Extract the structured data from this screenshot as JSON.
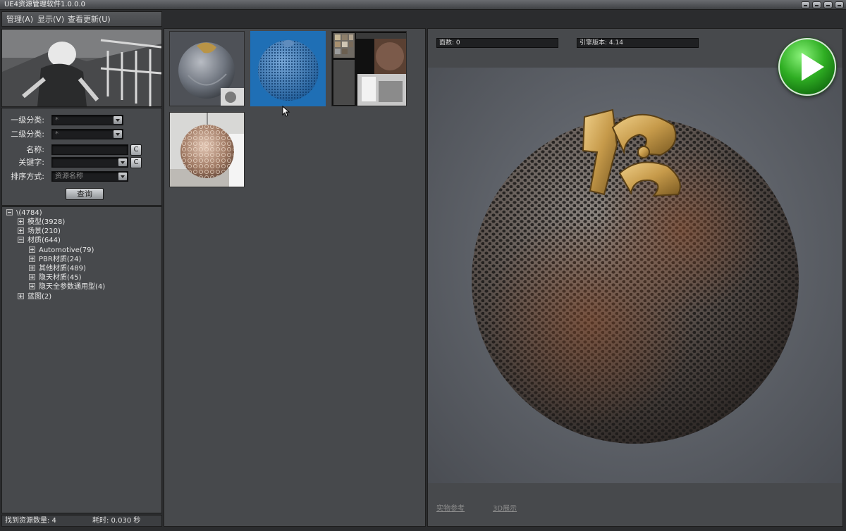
{
  "window": {
    "title": "UE4资源管理软件1.0.0.0"
  },
  "menu": [
    {
      "label": "管理(A)"
    },
    {
      "label": "显示(V)"
    },
    {
      "label": "查看更新(U)"
    }
  ],
  "filters": {
    "category1": {
      "label": "一级分类:",
      "value": "*"
    },
    "category2": {
      "label": "二级分类:",
      "value": "*"
    },
    "name": {
      "label": "名称:",
      "value": "",
      "clear": "C"
    },
    "keyword": {
      "label": "关键字:",
      "value": "",
      "clear": "C"
    },
    "sort": {
      "label": "排序方式:",
      "value": "资源名称"
    },
    "query_button": "查询"
  },
  "tree": {
    "root": "\\(4784)",
    "nodes": [
      {
        "label": "模型(3928)",
        "expanded": false,
        "level": 1
      },
      {
        "label": "场景(210)",
        "expanded": false,
        "level": 1
      },
      {
        "label": "材质(644)",
        "expanded": true,
        "level": 1
      },
      {
        "label": "Automotive(79)",
        "expanded": false,
        "level": 2
      },
      {
        "label": "PBR材质(24)",
        "expanded": false,
        "level": 2
      },
      {
        "label": "其他材质(489)",
        "expanded": false,
        "level": 2
      },
      {
        "label": "隐天材质(45)",
        "expanded": false,
        "level": 2
      },
      {
        "label": "隐天全参数通用型(4)",
        "expanded": false,
        "level": 2
      },
      {
        "label": "蓝图(2)",
        "expanded": false,
        "level": 1
      }
    ]
  },
  "status": {
    "found": "找到资源数量: 4",
    "elapsed": "耗时: 0.030 秒"
  },
  "info": {
    "faces": "面数: 0",
    "engine": "引擎版本: 4.14"
  },
  "links": {
    "reference": "实物参考",
    "three_d": "3D展示"
  },
  "thumbnails": [
    {
      "name": "thumb-gray-sphere",
      "selected": false
    },
    {
      "name": "thumb-blue-mesh-sphere",
      "selected": true
    },
    {
      "name": "thumb-screenshot-collage",
      "selected": false
    },
    {
      "name": "thumb-chandelier-sphere",
      "selected": false
    }
  ],
  "colors": {
    "panel": "#47494c",
    "selected_thumb": "#1d6fb8",
    "play_button": "#2fae23"
  }
}
